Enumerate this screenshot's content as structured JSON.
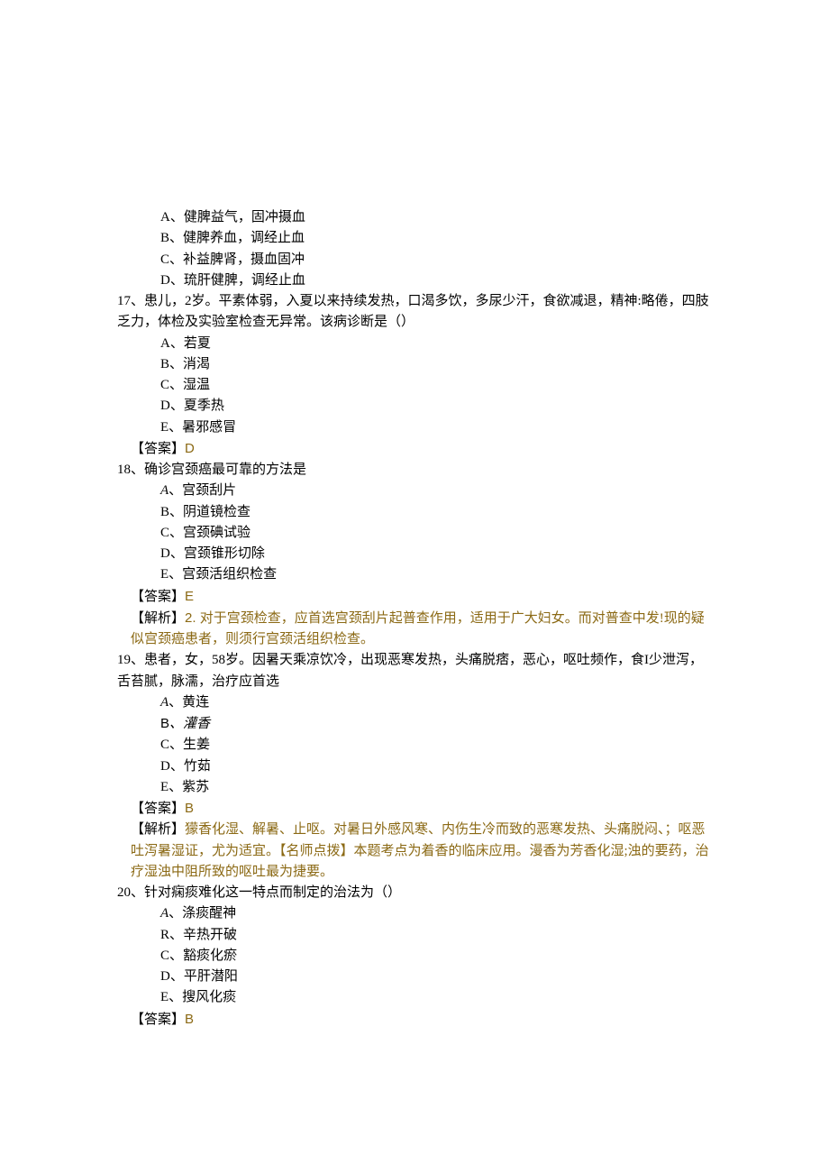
{
  "q16": {
    "options": {
      "A": "A、健脾益气，固冲摄血",
      "B": "B、健脾养血，调经止血",
      "C": "C、补益脾肾，摄血固冲",
      "D": "D、琉肝健脾，调经止血"
    }
  },
  "q17": {
    "stem": "17、患儿，2岁。平素体弱，入夏以来持续发热，口渴多饮，多尿少汗，食欲减退，精神:略倦，四肢乏力，体检及实验室检查无异常。该病诊断是（）",
    "options": {
      "A": "A、若夏",
      "B": "B、消渴",
      "C": "C、湿温",
      "D": "D、夏季热",
      "E": "E、暑邪感冒"
    },
    "answerLabel": "【答案】",
    "answer": "D"
  },
  "q18": {
    "stem": "18、确诊宫颈癌最可靠的方法是",
    "options": {
      "A": "、宫颈刮片",
      "B": "B、阴道镜检查",
      "C": "C、宫颈碘试验",
      "D": "D、宫颈锥形切除",
      "E": "E、宫颈活组织检查"
    },
    "optA_letter": "A",
    "answerLabel": "【答案】",
    "answer": "E",
    "explainLabel": "【解析】",
    "explainNum": "2. ",
    "explain": "对于宫颈检查，应首选宫颈刮片起普查作用，适用于广大妇女。而对普查中发!现的疑似宫颈癌患者，则须行宫颈活组织检查。"
  },
  "q19": {
    "stem": "19、患者，女，58岁。因暑天乘凉饮冷，出现恶寒发热，头痛脱痞，恶心，呕吐频作，食I少泄泻，舌苔腻，脉濡，治疗应首选",
    "options": {
      "A": "、黄连",
      "B": "、灌香",
      "C": "C、生姜",
      "D": "D、竹茹",
      "E": "E、紫苏"
    },
    "optA_letter": "A",
    "optB_letter": "B",
    "answerLabel": "【答案】",
    "answer": "B",
    "explainLabel": "【解析】",
    "explain": "獴香化湿、解暑、止呕。对暑日外感风寒、内伤生冷而致的恶寒发热、头痛脱闷、；呕恶吐泻暑湿证，尤为适宜。【名师点拨】本题考点为着香的临床应用。漫香为芳香化湿;浊的要药，治疗湿浊中阻所致的呕吐最为捷要。"
  },
  "q20": {
    "stem": "20、针对痫痰难化这一特点而制定的治法为（）",
    "options": {
      "A": "、涤痰醒神",
      "B": "R、辛热开破",
      "C": "C、豁痰化瘀",
      "D": "D、平肝潜阳",
      "E": "E、搜风化痰"
    },
    "optA_letter": "A",
    "answerLabel": "【答案】",
    "answer": "B"
  }
}
